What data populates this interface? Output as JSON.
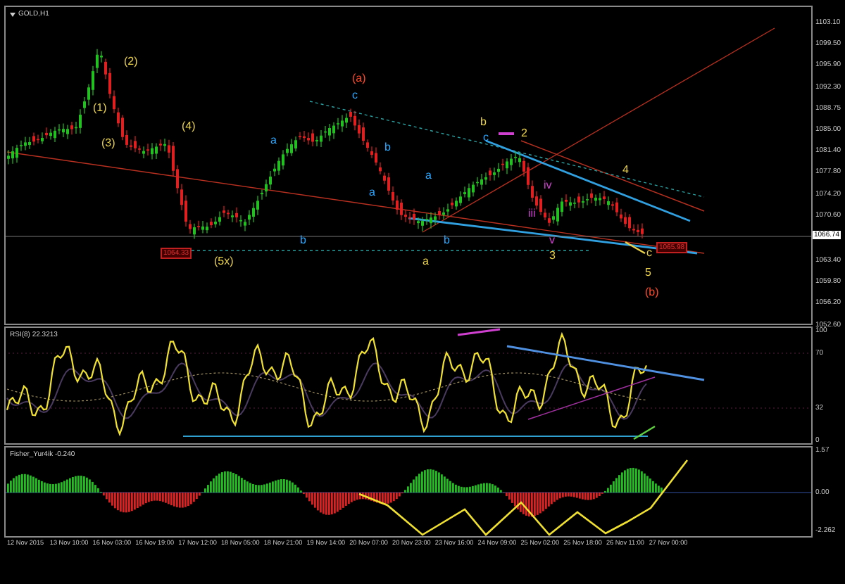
{
  "main_chart": {
    "title": "GOLD,H1",
    "price_axis": [
      "1103.10",
      "1099.50",
      "1095.90",
      "1092.30",
      "1088.75",
      "1085.00",
      "1081.40",
      "1077.80",
      "1074.20",
      "1070.60",
      "1063.40",
      "1059.80",
      "1056.20",
      "1052.60"
    ],
    "current_price": "1066.74",
    "price_tags": [
      "1064.33",
      "1065.98"
    ],
    "wave_labels": [
      {
        "text": "(2)",
        "color": "#e8d048"
      },
      {
        "text": "(1)",
        "color": "#e8d048"
      },
      {
        "text": "(3)",
        "color": "#e8d048"
      },
      {
        "text": "(4)",
        "color": "#e8d048"
      },
      {
        "text": "(5x)",
        "color": "#e8d048"
      },
      {
        "text": "(a)",
        "color": "#ff4a2a"
      },
      {
        "text": "c",
        "color": "#2aa8ff"
      },
      {
        "text": "a",
        "color": "#2aa8ff"
      },
      {
        "text": "b",
        "color": "#2aa8ff"
      },
      {
        "text": "a",
        "color": "#2aa8ff"
      },
      {
        "text": "b",
        "color": "#2aa8ff"
      },
      {
        "text": "a",
        "color": "#e8d048"
      },
      {
        "text": "b",
        "color": "#e8d048"
      },
      {
        "text": "c",
        "color": "#2aa8ff"
      },
      {
        "text": "2",
        "color": "#e8d048"
      },
      {
        "text": "a",
        "color": "#2aa8ff"
      },
      {
        "text": "b",
        "color": "#2aa8ff"
      },
      {
        "text": "iii",
        "color": "#d040d0"
      },
      {
        "text": "iv",
        "color": "#d040d0"
      },
      {
        "text": "v",
        "color": "#d040d0"
      },
      {
        "text": "3",
        "color": "#e8d048"
      },
      {
        "text": "4",
        "color": "#e8d048"
      },
      {
        "text": "c",
        "color": "#e8d048"
      },
      {
        "text": "5",
        "color": "#e8d048"
      },
      {
        "text": "(b)",
        "color": "#ff4a2a"
      }
    ]
  },
  "rsi_panel": {
    "title": "RSI(8) 22.3213",
    "axis": [
      "100",
      "70",
      "32",
      "0"
    ]
  },
  "fisher_panel": {
    "title": "Fisher_Yur4ik -0.240",
    "axis": [
      "1.57",
      "0.00",
      "-2.262"
    ]
  },
  "time_axis": [
    "12 Nov 2015",
    "13 Nov 10:00",
    "16 Nov 03:00",
    "16 Nov 19:00",
    "17 Nov 12:00",
    "18 Nov 05:00",
    "18 Nov 21:00",
    "19 Nov 14:00",
    "20 Nov 07:00",
    "20 Nov 23:00",
    "23 Nov 16:00",
    "24 Nov 09:00",
    "25 Nov 02:00",
    "25 Nov 18:00",
    "26 Nov 11:00",
    "27 Nov 00:00"
  ]
}
